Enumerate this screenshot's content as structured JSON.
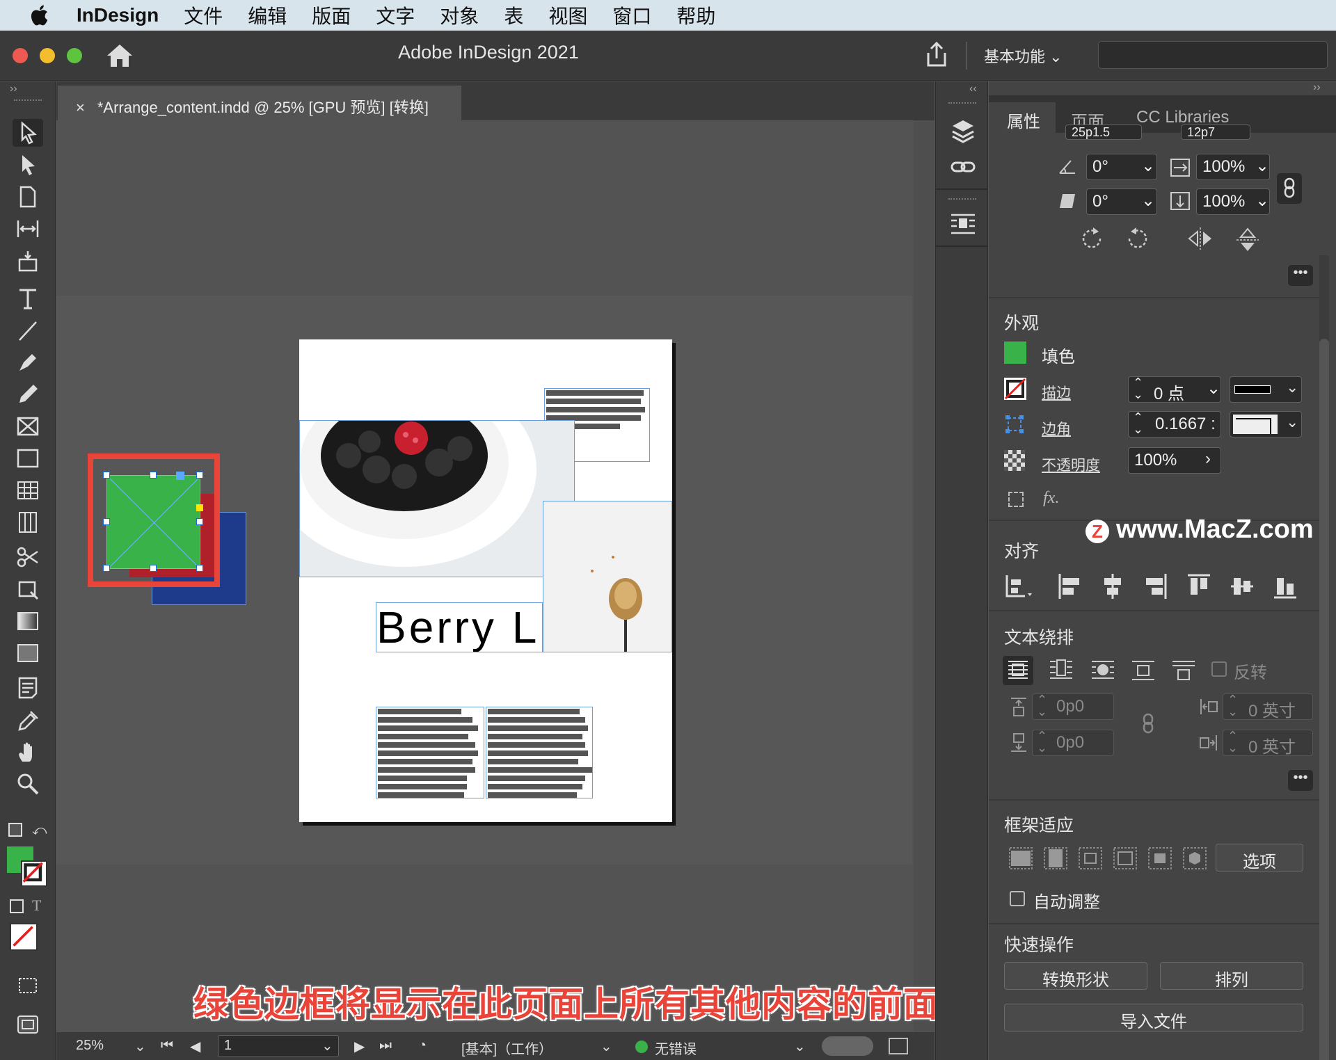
{
  "menubar": {
    "app": "InDesign",
    "items": [
      "文件",
      "编辑",
      "版面",
      "文字",
      "对象",
      "表",
      "视图",
      "窗口",
      "帮助"
    ]
  },
  "titlebar": {
    "title": "Adobe InDesign 2021",
    "workspace": "基本功能"
  },
  "document": {
    "tab_title": "*Arrange_content.indd @ 25% [GPU 预览] [转换]",
    "close": "×",
    "headline": "Berry L"
  },
  "status": {
    "zoom": "25%",
    "page": "1",
    "profile": "[基本]（工作）",
    "preflight": "无错误"
  },
  "properties": {
    "tabs": [
      "属性",
      "页面",
      "CC Libraries"
    ],
    "transform": {
      "rotate": "0°",
      "shear": "0°",
      "scale_x": "100%",
      "scale_y": "100%",
      "partial_top": "25p1.5",
      "partial_h": "12p7"
    },
    "appearance": {
      "title": "外观",
      "fill_label": "填色",
      "stroke_label": "描边",
      "stroke_value": "0 点",
      "corner_label": "边角",
      "corner_value": "0.1667 :",
      "opacity_label": "不透明度",
      "opacity_value": "100%",
      "fx": "fx.",
      "fill_color": "#3ab24a"
    },
    "align": {
      "title": "对齐"
    },
    "textwrap": {
      "title": "文本绕排",
      "invert": "反转",
      "top": "0p0",
      "bottom": "0p0",
      "left": "0 英寸",
      "right": "0 英寸"
    },
    "frame_fit": {
      "title": "框架适应",
      "options": "选项",
      "auto_fit": "自动调整"
    },
    "quick_actions": {
      "title": "快速操作",
      "convert_shape": "转换形状",
      "arrange": "排列",
      "import_file": "导入文件"
    }
  },
  "caption": "绿色边框将显示在此页面上所有其他内容的前面",
  "watermark": "www.MacZ.com",
  "colors": {
    "accent_selection": "#e8443a",
    "green": "#3ab24a",
    "blue": "#1e3a8a",
    "red": "#b0202a"
  }
}
